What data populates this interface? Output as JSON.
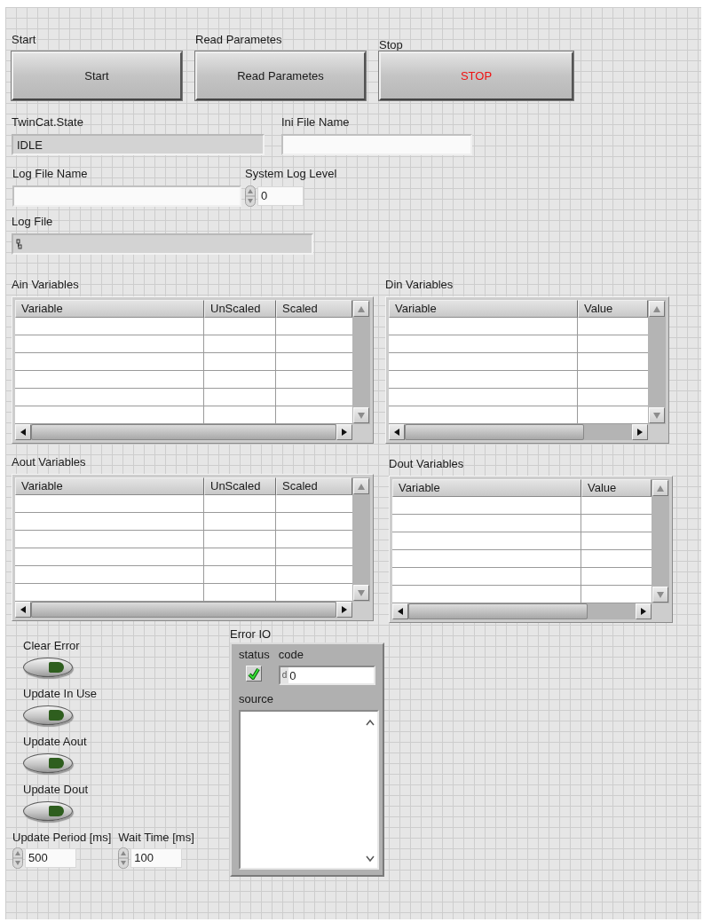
{
  "buttons": [
    {
      "label": "Start",
      "caption": "Start",
      "kind": "normal"
    },
    {
      "label": "Read Parametes",
      "caption": "Read Parametes",
      "kind": "normal"
    },
    {
      "label": "Stop",
      "caption": "STOP",
      "kind": "stop"
    }
  ],
  "twincat_state": {
    "label": "TwinCat.State",
    "value": "IDLE"
  },
  "ini_file_name": {
    "label": "Ini File Name"
  },
  "log_file_name": {
    "label": "Log File Name"
  },
  "system_log_level": {
    "label": "System Log Level",
    "value": "0"
  },
  "log_file": {
    "label": "Log File"
  },
  "tables": [
    {
      "label": "Ain Variables",
      "columns": [
        "Variable",
        "UnScaled",
        "Scaled"
      ]
    },
    {
      "label": "Din Variables",
      "columns": [
        "Variable",
        "Value"
      ]
    },
    {
      "label": "Aout Variables",
      "columns": [
        "Variable",
        "UnScaled",
        "Scaled"
      ]
    },
    {
      "label": "Dout Variables",
      "columns": [
        "Variable",
        "Value"
      ]
    }
  ],
  "switches": [
    {
      "label": "Clear Error",
      "on": false
    },
    {
      "label": "Update In Use",
      "on": false
    },
    {
      "label": "Update Aout",
      "on": false
    },
    {
      "label": "Update Dout",
      "on": false
    }
  ],
  "update_period": {
    "label": "Update Period [ms]",
    "value": "500"
  },
  "wait_time": {
    "label": "Wait Time [ms]",
    "value": "100"
  },
  "error_io": {
    "label": "Error IO",
    "status_label": "status",
    "status_error": false,
    "code_label": "code",
    "code_radix": "d",
    "code": "0",
    "source_label": "source"
  }
}
